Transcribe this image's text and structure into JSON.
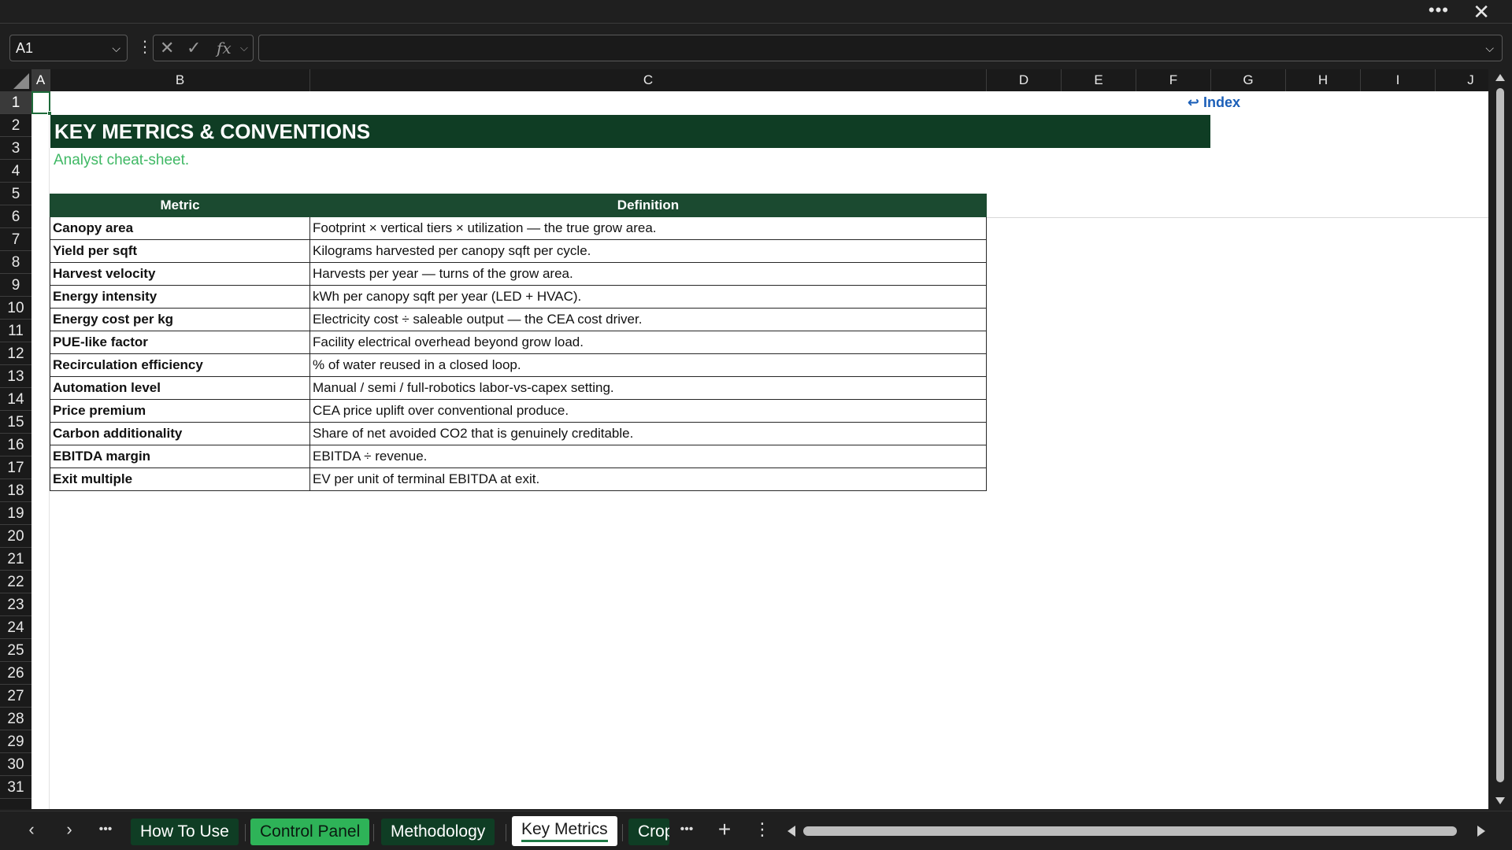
{
  "window": {
    "more_glyph": "•••",
    "close_glyph": "✕"
  },
  "formula_bar": {
    "name_box": "A1",
    "fx_cancel": "✕",
    "fx_confirm": "✓",
    "fx_label": "fx",
    "formula": ""
  },
  "columns": [
    "A",
    "B",
    "C",
    "D",
    "E",
    "F",
    "G",
    "H",
    "I",
    "J"
  ],
  "rows": [
    "1",
    "2",
    "3",
    "4",
    "5",
    "6",
    "7",
    "8",
    "9",
    "10",
    "11",
    "12",
    "13",
    "14",
    "15",
    "16",
    "17",
    "18",
    "19",
    "20",
    "21",
    "22",
    "23",
    "24",
    "25",
    "26",
    "27",
    "28",
    "29",
    "30",
    "31"
  ],
  "sheet": {
    "index_link": "↩ Index",
    "title": "KEY METRICS & CONVENTIONS",
    "subtitle": "Analyst cheat-sheet.",
    "table": {
      "headers": [
        "Metric",
        "Definition"
      ],
      "rows": [
        [
          "Canopy area",
          "Footprint × vertical tiers × utilization — the true grow area."
        ],
        [
          "Yield per sqft",
          "Kilograms harvested per canopy sqft per cycle."
        ],
        [
          "Harvest velocity",
          "Harvests per year — turns of the grow area."
        ],
        [
          "Energy intensity",
          "kWh per canopy sqft per year (LED + HVAC)."
        ],
        [
          "Energy cost per kg",
          "Electricity cost ÷ saleable output — the CEA cost driver."
        ],
        [
          "PUE-like factor",
          "Facility electrical overhead beyond grow load."
        ],
        [
          "Recirculation efficiency",
          "% of water reused in a closed loop."
        ],
        [
          "Automation level",
          "Manual / semi / full-robotics labor-vs-capex setting."
        ],
        [
          "Price premium",
          "CEA price uplift over conventional produce."
        ],
        [
          "Carbon additionality",
          "Share of net avoided CO2 that is genuinely creditable."
        ],
        [
          "EBITDA margin",
          "EBITDA ÷ revenue."
        ],
        [
          "Exit multiple",
          "EV per unit of terminal EBITDA at exit."
        ]
      ]
    }
  },
  "tabs": {
    "prev": "‹",
    "next": "›",
    "more": "•••",
    "items": [
      "How To Use",
      "Control Panel",
      "Methodology",
      "Key Metrics",
      "Crop"
    ],
    "more2": "•••",
    "add": "+",
    "options": "⋮"
  },
  "colors": {
    "title_band": "#0f3d24",
    "header_row": "#1b4a30",
    "subtitle": "#3fb864",
    "link": "#1b5fb8"
  }
}
